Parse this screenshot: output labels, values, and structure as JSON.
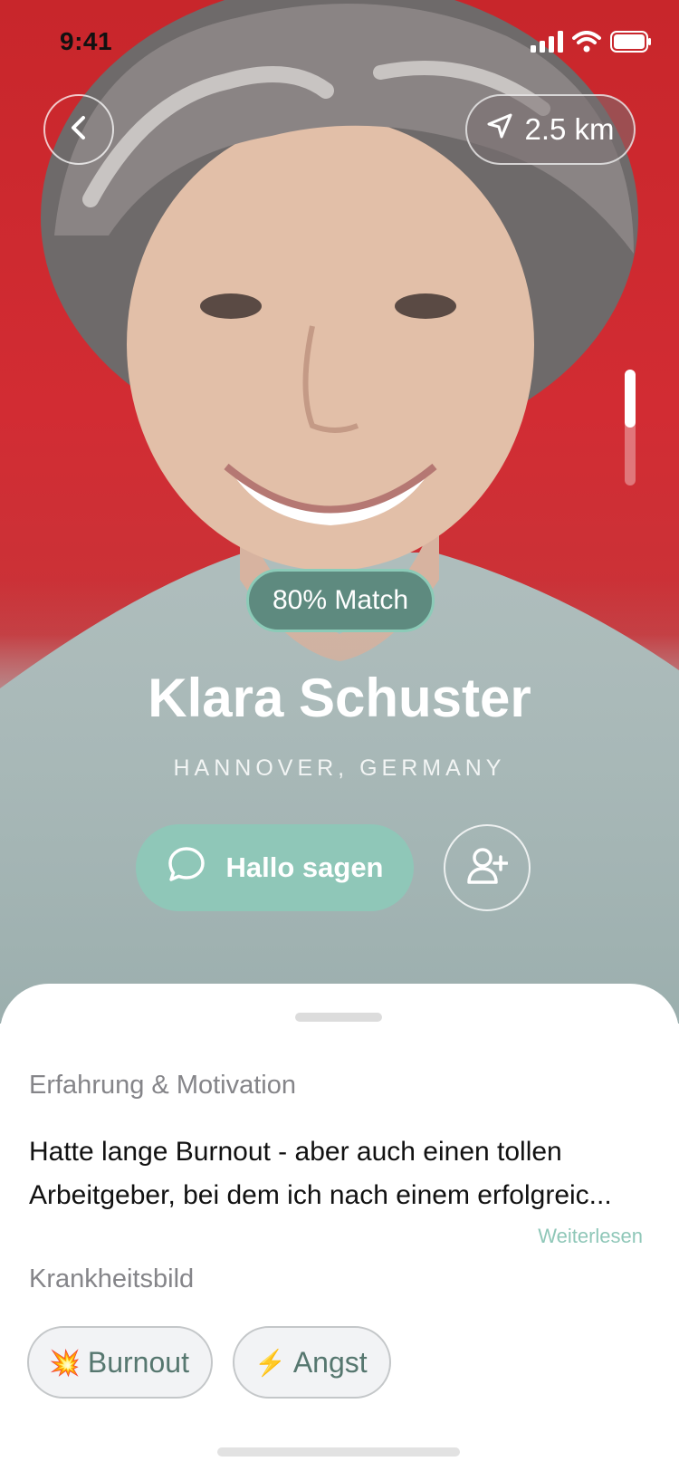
{
  "status_bar": {
    "time": "9:41"
  },
  "top_bar": {
    "distance": "2.5 km"
  },
  "profile": {
    "match": "80% Match",
    "name": "Klara Schuster",
    "location": "HANNOVER, GERMANY"
  },
  "actions": {
    "hello_label": "Hallo sagen"
  },
  "sheet": {
    "experience_title": "Erfahrung & Motivation",
    "experience_line1": "Hatte  lange Burnout - aber auch einen tollen",
    "experience_line2": "Arbeitgeber, bei dem ich nach einem erfolgreic...",
    "read_more": "Weiterlesen",
    "condition_title": "Krankheitsbild",
    "tags": [
      {
        "emoji": "💥",
        "label": "Burnout"
      },
      {
        "emoji": "⚡",
        "label": "Angst"
      }
    ]
  },
  "colors": {
    "accent": "#8fc7b8",
    "match_bg": "#5e8a7f",
    "photo_bg": "#c8262b"
  },
  "icons": [
    "back-chevron-icon",
    "navigation-arrow-icon",
    "chat-bubble-icon",
    "add-user-icon",
    "signal-icon",
    "wifi-icon",
    "battery-icon"
  ]
}
